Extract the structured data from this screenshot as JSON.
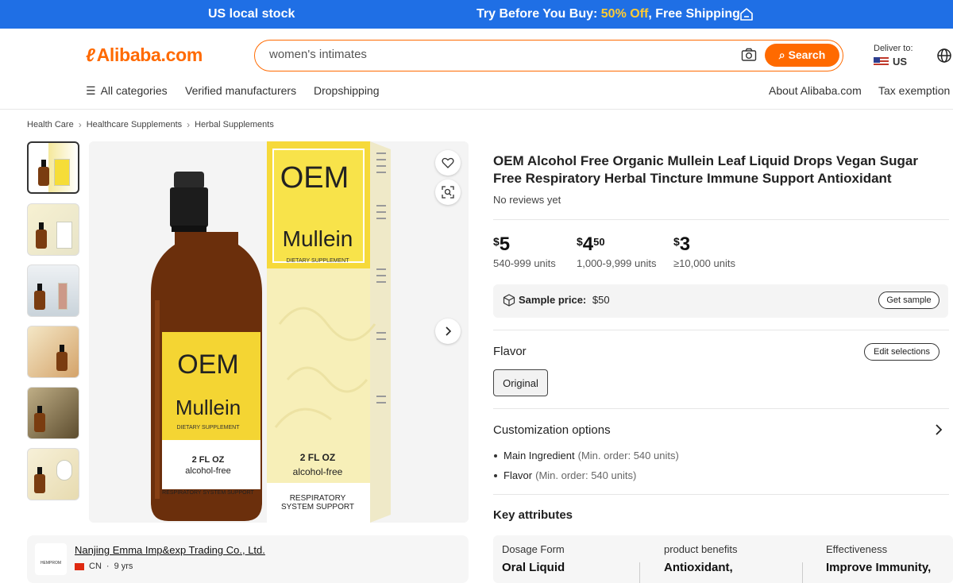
{
  "promo": {
    "left": "US local stock",
    "right_prefix": "Try Before You Buy: ",
    "right_highlight": "50% Off",
    "right_suffix": ", Free Shipping"
  },
  "header": {
    "logo": "Alibaba.com",
    "search_value": "women's intimates",
    "search_button": "Search",
    "deliver_label": "Deliver to:",
    "deliver_country": "US"
  },
  "nav": {
    "all_categories": "All categories",
    "verified": "Verified manufacturers",
    "dropshipping": "Dropshipping",
    "about": "About Alibaba.com",
    "tax": "Tax exemption"
  },
  "breadcrumb": [
    "Health Care",
    "Healthcare Supplements",
    "Herbal Supplements"
  ],
  "gallery": {
    "box_brand": "OEM",
    "box_product": "Mullein",
    "box_sub": "DIETARY SUPPLEMENT",
    "bottle_brand": "OEM",
    "bottle_product": "Mullein",
    "bottle_sub": "DIETARY SUPPLEMENT",
    "size": "2 FL OZ",
    "alcohol": "alcohol-free",
    "bottle_footer": "RESPIRATORY SYSTEM SUPPORT",
    "box_size": "2 FL OZ",
    "box_alcohol": "alcohol-free",
    "box_footer1": "RESPIRATORY",
    "box_footer2": "SYSTEM SUPPORT"
  },
  "seller": {
    "logo_text": "HEMPROM",
    "name": "Nanjing Emma Imp&exp Trading Co., Ltd.",
    "country": "CN",
    "years": "9 yrs"
  },
  "product": {
    "title": "OEM Alcohol Free Organic Mullein Leaf Liquid Drops Vegan Sugar Free Respiratory Herbal Tincture Immune Support Antioxidant",
    "reviews": "No reviews yet",
    "prices": [
      {
        "currency": "$",
        "whole": "5",
        "decimal": "",
        "units": "540-999 units"
      },
      {
        "currency": "$",
        "whole": "4",
        "decimal": "50",
        "units": "1,000-9,999 units"
      },
      {
        "currency": "$",
        "whole": "3",
        "decimal": "",
        "units": "≥10,000 units"
      }
    ],
    "sample_label": "Sample price:",
    "sample_value": "$50",
    "get_sample": "Get sample",
    "flavor_label": "Flavor",
    "edit_selections": "Edit selections",
    "flavor_option": "Original",
    "customization_label": "Customization options",
    "custom_items": [
      {
        "name": "Main Ingredient",
        "min": "(Min. order: 540 units)"
      },
      {
        "name": "Flavor",
        "min": "(Min. order: 540 units)"
      }
    ],
    "key_attributes_label": "Key attributes",
    "attributes": [
      {
        "key": "Dosage Form",
        "value": "Oral Liquid"
      },
      {
        "key": "product benefits",
        "value": "Antioxidant,"
      },
      {
        "key": "Effectiveness",
        "value": "Improve Immunity,"
      }
    ]
  }
}
